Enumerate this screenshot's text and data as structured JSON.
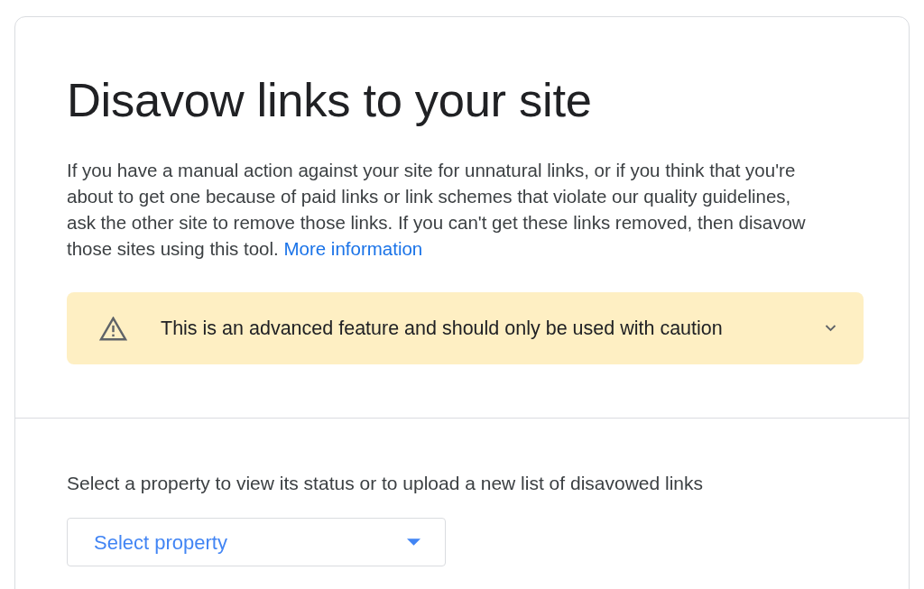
{
  "page": {
    "title": "Disavow links to your site"
  },
  "intro": {
    "text": "If you have a manual action against your site for unnatural links, or if you think that you're about to get one because of paid links or link schemes that violate our quality guidelines, ask the other site to remove those links. If you can't get these links removed, then disavow those sites using this tool.",
    "link": "More information"
  },
  "warning": {
    "text": "This is an advanced feature and should only be used with caution",
    "expanded": false
  },
  "property_section": {
    "prompt": "Select a property to view its status or to upload a new list of disavowed links",
    "dropdown": {
      "label": "Select property"
    }
  }
}
